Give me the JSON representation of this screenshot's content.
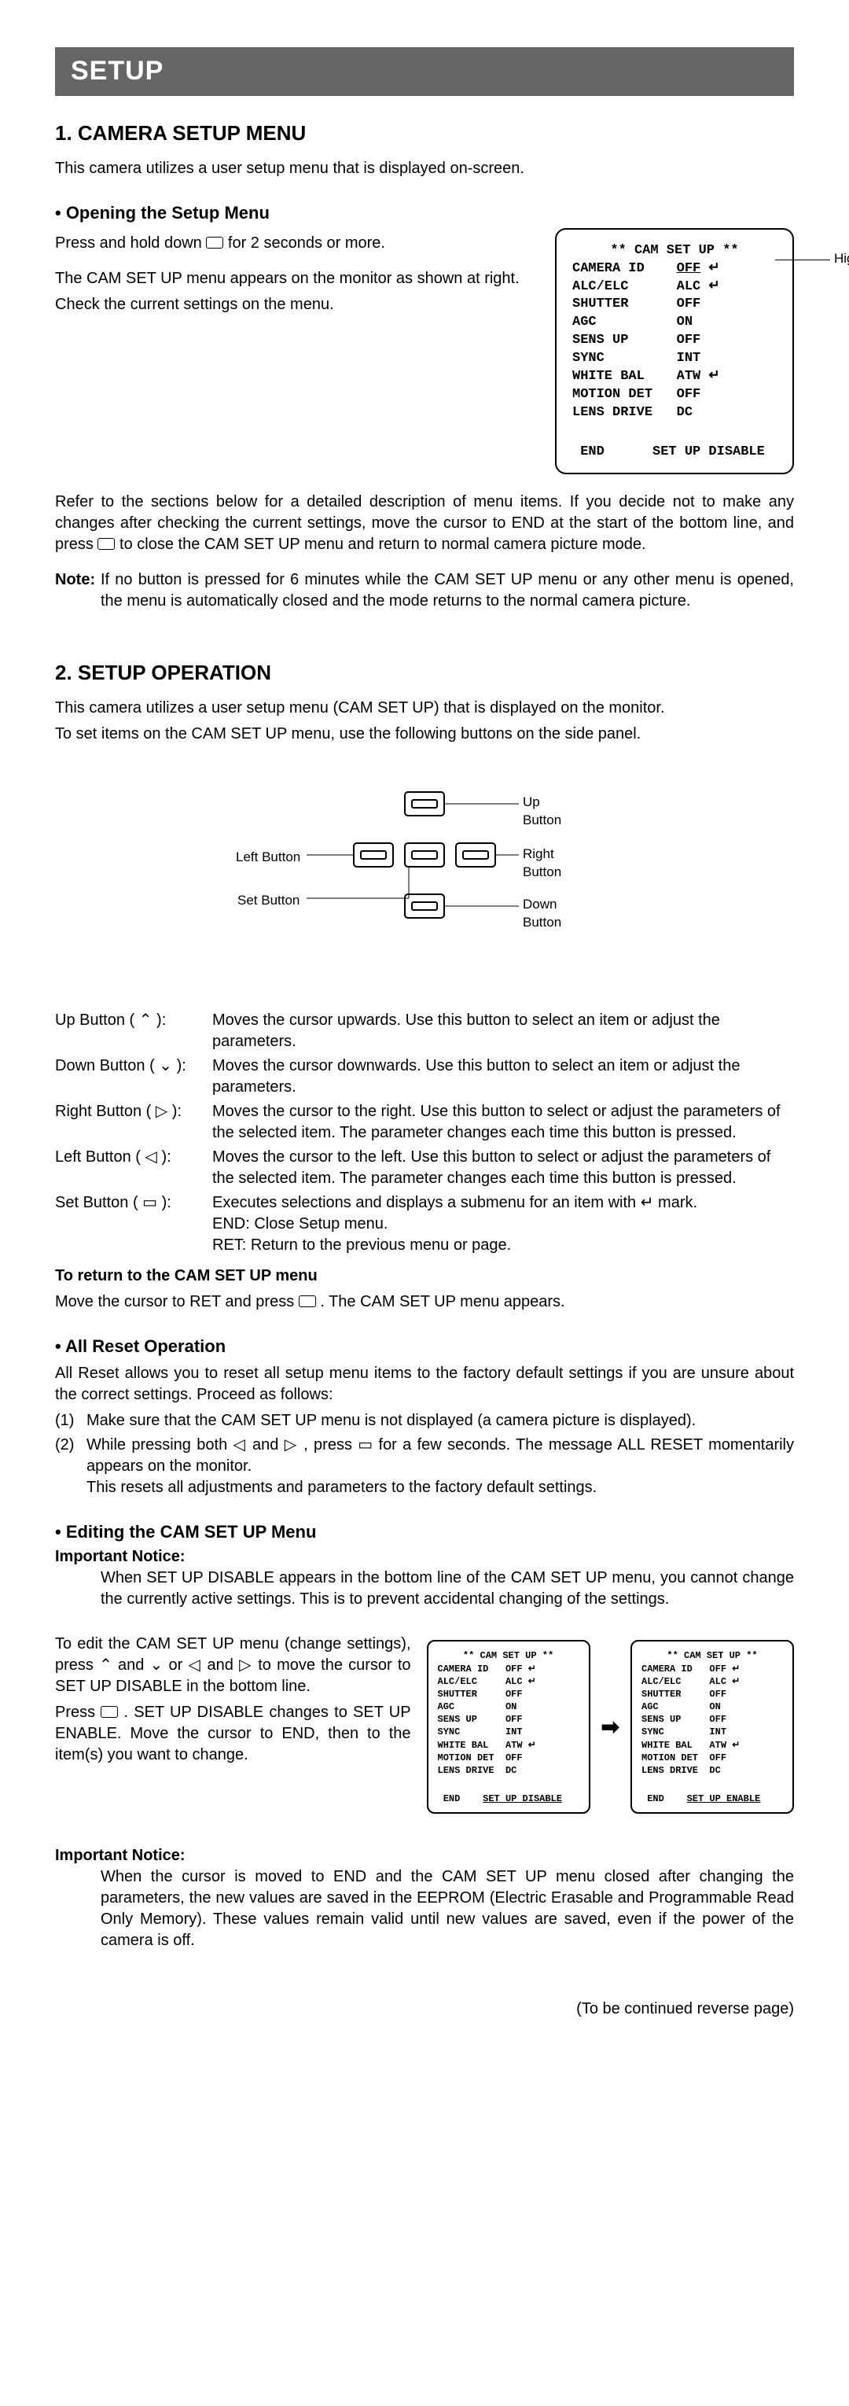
{
  "header": {
    "title": "SETUP"
  },
  "s1": {
    "heading": "1. CAMERA SETUP MENU",
    "intro": "This camera utilizes a user setup menu that is displayed on-screen.",
    "open_sub": "• Opening the Setup Menu",
    "open_p1a": "Press and hold down ",
    "open_p1b": " for 2 seconds or more.",
    "open_p2": "The CAM SET UP menu appears on the monitor as shown at right.",
    "open_p3": "Check the current settings on the menu.",
    "hl_label": "Highlighted",
    "refer_p1": "Refer to the sections below for a detailed description of menu items.  If you decide not to make any changes after checking the current settings, move the cursor to END at the start of the bottom line, and press ",
    "refer_p2": " to close the CAM SET UP menu and return to normal camera picture mode.",
    "note_label": "Note:",
    "note_text": "If no button is pressed for 6 minutes while the CAM SET UP menu or any other menu is opened, the menu is automatically closed and the mode returns to the normal camera picture."
  },
  "osd": {
    "title": "** CAM SET UP **",
    "rows": [
      {
        "k": "CAMERA ID",
        "v": "OFF",
        "mark": "↵",
        "hl": true
      },
      {
        "k": "ALC/ELC",
        "v": "ALC",
        "mark": "↵"
      },
      {
        "k": "SHUTTER",
        "v": "OFF",
        "mark": ""
      },
      {
        "k": "AGC",
        "v": "ON",
        "mark": ""
      },
      {
        "k": "SENS UP",
        "v": "OFF",
        "mark": ""
      },
      {
        "k": "SYNC",
        "v": "INT",
        "mark": ""
      },
      {
        "k": "WHITE BAL",
        "v": "ATW",
        "mark": "↵"
      },
      {
        "k": "MOTION DET",
        "v": "OFF",
        "mark": ""
      },
      {
        "k": "LENS DRIVE",
        "v": "DC",
        "mark": ""
      }
    ],
    "bottom_left": "END",
    "bottom_right_disable": "SET UP DISABLE",
    "bottom_right_enable": "SET UP ENABLE"
  },
  "s2": {
    "heading": "2. SETUP OPERATION",
    "intro1": "This camera utilizes a user setup menu (CAM SET UP) that is displayed on the monitor.",
    "intro2": "To set items on the CAM SET UP menu, use the following buttons on the side panel.",
    "diag": {
      "up": "Up\nButton",
      "down": "Down\nButton",
      "left": "Left Button",
      "right": "Right\nButton",
      "set": "Set Button"
    },
    "buttons": [
      {
        "name": "Up Button ( ⌃ ):",
        "desc": "Moves the cursor upwards.  Use this button to select an item or adjust the parameters."
      },
      {
        "name": "Down Button ( ⌄ ):",
        "desc": "Moves the cursor downwards.  Use this button to select an item or adjust the parameters."
      },
      {
        "name": "Right Button ( ▷ ):",
        "desc": "Moves the cursor to the right.  Use this button to select or adjust the parameters of the selected item.  The parameter changes each time this button is pressed."
      },
      {
        "name": "Left Button ( ◁ ):",
        "desc": "Moves the cursor to the left.  Use this button to select or adjust the parameters of the selected item.  The parameter changes each time this button is pressed."
      },
      {
        "name": "Set Button ( ▭ ):",
        "desc": "Executes selections and displays a submenu for an item with  ↵  mark.\nEND: Close Setup menu.\nRET: Return to the previous menu or page."
      }
    ],
    "return_title": "To return to the CAM SET UP menu",
    "return_p_a": "Move the cursor to RET and press ",
    "return_p_b": " .  The CAM SET UP menu appears.",
    "allreset_sub": "• All Reset Operation",
    "allreset_intro": "All Reset allows you to reset all setup menu items to the factory default settings if you are unsure about the correct settings.  Proceed as follows:",
    "allreset_steps": [
      "Make sure that the CAM SET UP menu is not displayed (a camera picture is displayed).",
      "While pressing both  ◁  and  ▷ , press  ▭  for a few seconds.  The message ALL RESET momentarily appears on the monitor.\nThis resets all adjustments and parameters to the factory default settings."
    ],
    "edit_sub": "• Editing the CAM SET UP Menu",
    "edit_notice_label": "Important Notice:",
    "edit_notice_text": "When SET UP DISABLE appears in the bottom line of the CAM SET UP menu, you cannot change the currently active settings.  This is to prevent accidental changing of the settings.",
    "edit_p1": "To edit the CAM SET UP menu (change settings), press  ⌃  and  ⌄  or  ◁  and  ▷  to move the cursor to SET UP DISABLE in the bottom line.",
    "edit_p2_a": "Press ",
    "edit_p2_b": " .  SET UP DISABLE changes to SET UP ENABLE.  Move the cursor to END, then to the item(s) you want to change.",
    "notice2_label": "Important Notice:",
    "notice2_text": "When the cursor is moved to END and the CAM SET UP menu closed after changing the parameters, the new values are saved in the EEPROM (Electric Erasable and Programmable Read Only Memory).  These values remain valid until new values are saved, even if the power of the camera is off."
  },
  "footer": {
    "text": "(To be continued reverse page)"
  }
}
